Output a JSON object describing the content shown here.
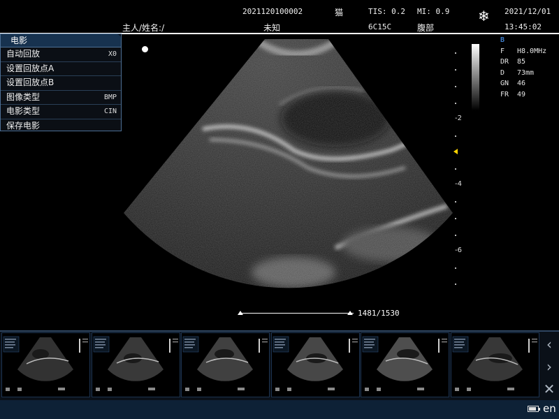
{
  "header": {
    "patient_id": "2021120100002",
    "species": "猫",
    "tis": "TIS: 0.2",
    "mi": "MI: 0.9",
    "date": "2021/12/01",
    "owner_name": "主人/姓名:/",
    "unknown": "未知",
    "probe": "6C15C",
    "exam": "腹部",
    "time": "13:45:02",
    "freeze_icon": "snowflake-icon"
  },
  "cine_menu": {
    "title": "电影",
    "items": [
      {
        "label": "自动回放",
        "value": "X0"
      },
      {
        "label": "设置回放点A",
        "value": ""
      },
      {
        "label": "设置回放点B",
        "value": ""
      },
      {
        "label": "图像类型",
        "value": "BMP"
      },
      {
        "label": "电影类型",
        "value": "CIN"
      },
      {
        "label": "保存电影",
        "value": ""
      }
    ]
  },
  "depth_scale": {
    "labels": [
      "-2",
      "-4",
      "-6"
    ]
  },
  "params": {
    "mode": "B",
    "rows": [
      {
        "key": "F",
        "value": "H8.0MHz"
      },
      {
        "key": "DR",
        "value": "85"
      },
      {
        "key": "D",
        "value": "73mm"
      },
      {
        "key": "GN",
        "value": "46"
      },
      {
        "key": "FR",
        "value": "49"
      }
    ]
  },
  "cine": {
    "frame_label": "1481/1530",
    "current_frame": 1481,
    "total_frames": 1530
  },
  "thumbnails_count": 6,
  "nav_buttons": {
    "prev": "‹",
    "next": "›",
    "close": "✕"
  },
  "status_bar": {
    "battery_level": 0.8,
    "language": "en"
  },
  "colors": {
    "menu_title_bg": "#17324f",
    "menu_border": "#4d6f94",
    "param_title": "#3d7cc9",
    "focus_marker": "#ffd400",
    "bottom_bar": "#0d2136"
  }
}
